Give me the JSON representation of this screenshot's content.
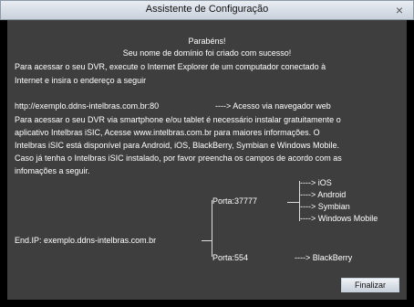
{
  "window": {
    "title": "Assistente de Configuração",
    "close_icon": "×"
  },
  "text": {
    "congrats": "Parabéns!",
    "created": "Seu nome de domínio foi criado com sucesso!",
    "access_line1": "Para acessar o seu DVR, execute o Internet Explorer de um computador conectado à",
    "access_line2": "Internet e insira o endereço a seguir",
    "url": "http://exemplo.ddns-intelbras.com.br:80",
    "url_arrow": "----> Acesso via navegador web",
    "smart_line1": "Para acessar o seu DVR via smartphone e/ou tablet é necessário instalar gratuitamente o",
    "smart_line2": "aplicativo Intelbras iSIC, Acesse www.intelbras.com.br para maiores informações. O",
    "smart_line3": "Intelbras iSIC está disponível para Android, iOS, BlackBerry, Symbian e Windows Mobile.",
    "smart_line4": "Caso já tenha o Intelbras iSIC instalado, por favor preencha os campos de acordo com as",
    "smart_line5": "infomações a seguir."
  },
  "diagram": {
    "endip": "End.IP: exemplo.ddns-intelbras.com.br",
    "port1": "Porta:37777",
    "port2": "Porta:554",
    "ios": "----> iOS",
    "android": "----> Android",
    "symbian": "----> Symbian",
    "winmobile": "----> Windows Mobile",
    "blackberry": "----> BlackBerry"
  },
  "buttons": {
    "finish": "Finalizar"
  }
}
